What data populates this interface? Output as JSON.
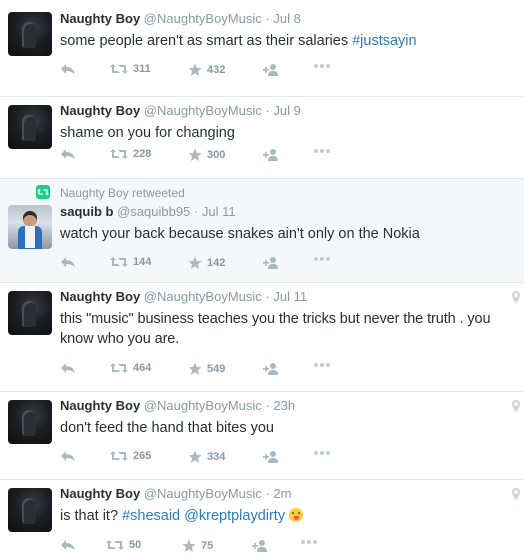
{
  "tweets": [
    {
      "name": "Naughty Boy",
      "handle": "@NaughtyBoyMusic",
      "sep": "·",
      "time": "Jul 8",
      "text": "some people aren't as smart as their salaries ",
      "tags": [
        "#justsayin"
      ],
      "retweets": "311",
      "favorites": "432"
    },
    {
      "name": "Naughty Boy",
      "handle": "@NaughtyBoyMusic",
      "sep": "·",
      "time": "Jul 9",
      "text": "shame on you for changing",
      "retweets": "228",
      "favorites": "300"
    },
    {
      "retweeted_by": "Naughty Boy retweeted",
      "name": "saquib b",
      "handle": "@saquibb95",
      "sep": "·",
      "time": "Jul 11",
      "text": "watch your back because snakes ain't only on the Nokia",
      "retweets": "144",
      "favorites": "142"
    },
    {
      "name": "Naughty Boy",
      "handle": "@NaughtyBoyMusic",
      "sep": "·",
      "time": "Jul 11",
      "text_line1": "this \"music\" business teaches you the tricks but never the truth . you",
      "text_line2": "know who you are.",
      "retweets": "464",
      "favorites": "549"
    },
    {
      "name": "Naughty Boy",
      "handle": "@NaughtyBoyMusic",
      "sep": "·",
      "time": "23h",
      "text": "don't feed the hand that bites you",
      "retweets": "265",
      "favorites": "334"
    },
    {
      "name": "Naughty Boy",
      "handle": "@NaughtyBoyMusic",
      "sep": "·",
      "time": "2m",
      "text": "is that it? ",
      "tags": [
        "#shesaid",
        "@kreptplaydirty"
      ],
      "retweets": "50",
      "favorites": "75"
    }
  ],
  "icons": {
    "reply": "reply-icon",
    "retweet": "retweet-icon",
    "favorite": "star-icon",
    "follow": "follow-icon",
    "more": "more-icon",
    "location": "location-pin-icon",
    "emoji": "tongue-out-emoji"
  },
  "colors": {
    "link": "#2b7bb9",
    "muted": "#8899a6",
    "retweet_green": "#19cf86",
    "shaded_bg": "#f5f8fa"
  }
}
